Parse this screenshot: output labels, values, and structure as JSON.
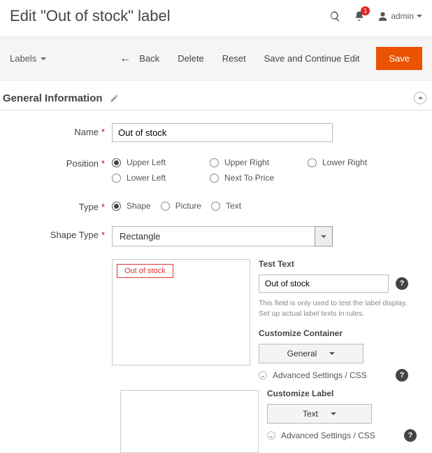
{
  "header": {
    "title": "Edit \"Out of stock\" label",
    "notification_count": "1",
    "username": "admin"
  },
  "toolbar": {
    "dropdown": "Labels",
    "back": "Back",
    "delete": "Delete",
    "reset": "Reset",
    "saveContinue": "Save and Continue Edit",
    "save": "Save"
  },
  "section": {
    "title": "General Information"
  },
  "fields": {
    "name": {
      "label": "Name",
      "value": "Out of stock"
    },
    "position": {
      "label": "Position",
      "options": [
        "Upper Left",
        "Upper Right",
        "Lower Right",
        "Lower Left",
        "Next To Price"
      ],
      "selected": "Upper Left"
    },
    "type": {
      "label": "Type",
      "options": [
        "Shape",
        "Picture",
        "Text"
      ],
      "selected": "Shape"
    },
    "shapeType": {
      "label": "Shape Type",
      "value": "Rectangle"
    },
    "preview": {
      "tag": "Out of stock"
    },
    "testText": {
      "label": "Test Text",
      "value": "Out of stock",
      "hint": "This field is only used to test the label display. Set up actual label texts in rules."
    },
    "customizeContainer": {
      "label": "Customize Container",
      "selected": "General",
      "advanced": "Advanced Settings / CSS"
    },
    "customizeLabel": {
      "label": "Customize Label",
      "selected": "Text",
      "advanced": "Advanced Settings / CSS"
    }
  }
}
